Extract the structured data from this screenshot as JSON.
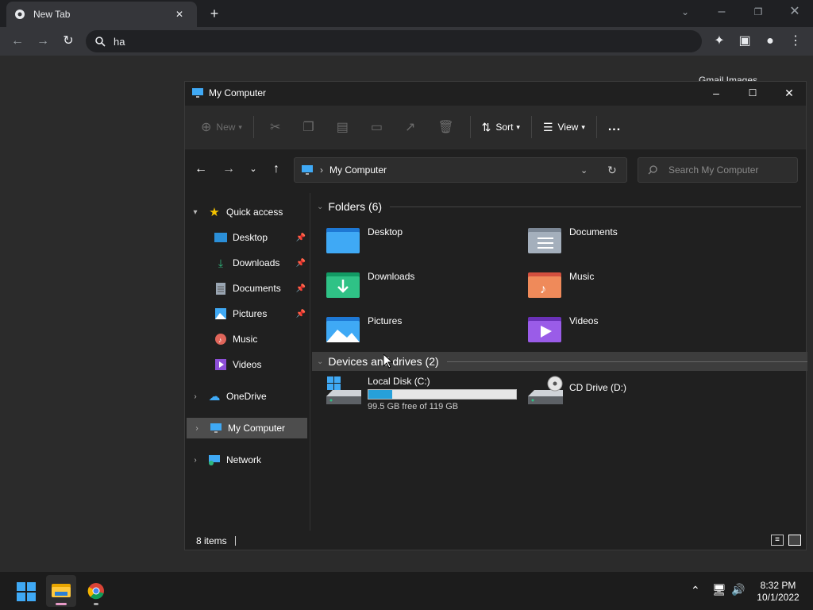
{
  "browser": {
    "tab_title": "New Tab",
    "omnibox_value": "ha",
    "page_links": "Gmail  Images"
  },
  "explorer": {
    "title": "My Computer",
    "cmd": {
      "new": "New",
      "sort": "Sort",
      "view": "View",
      "more": "..."
    },
    "address": "My Computer",
    "search_placeholder": "Search My Computer",
    "sidebar": {
      "quick_access": "Quick access",
      "desktop": "Desktop",
      "downloads": "Downloads",
      "documents": "Documents",
      "pictures": "Pictures",
      "music": "Music",
      "videos": "Videos",
      "onedrive": "OneDrive",
      "my_computer": "My Computer",
      "network": "Network"
    },
    "folders_header": "Folders (6)",
    "folders": [
      "Desktop",
      "Documents",
      "Downloads",
      "Music",
      "Pictures",
      "Videos"
    ],
    "devices_header": "Devices and drives (2)",
    "drive_c": {
      "name": "Local Disk (C:)",
      "free": "99.5 GB free of 119 GB",
      "used_fraction": 0.16
    },
    "drive_d": {
      "name": "CD Drive (D:)"
    },
    "status": "8 items"
  },
  "taskbar": {
    "time": "8:32 PM",
    "date": "10/1/2022"
  }
}
